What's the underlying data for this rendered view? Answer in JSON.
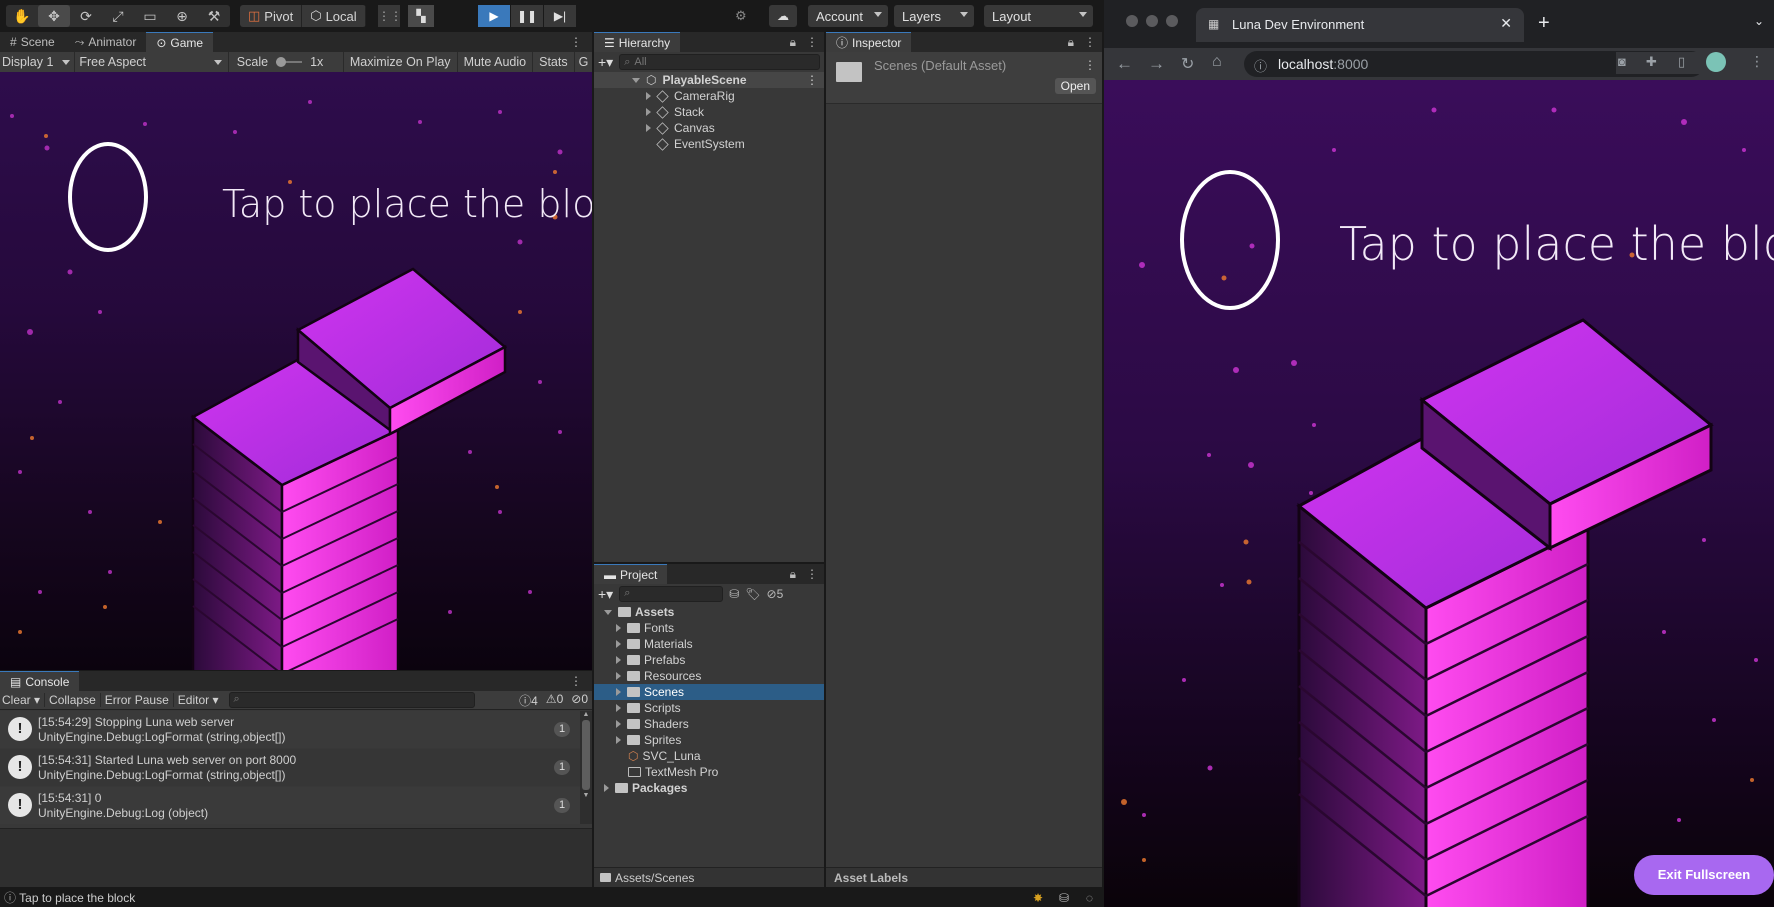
{
  "toolbar": {
    "pivot_label": "Pivot",
    "local_label": "Local",
    "account_label": "Account",
    "layers_label": "Layers",
    "layout_label": "Layout"
  },
  "scene_tabs": {
    "scene": "Scene",
    "animator": "Animator",
    "game": "Game"
  },
  "game_toolbar": {
    "display": "Display 1",
    "aspect": "Free Aspect",
    "scale_label": "Scale",
    "scale_value": "1x",
    "maximize": "Maximize On Play",
    "mute": "Mute Audio",
    "stats": "Stats",
    "gizmos": "G"
  },
  "game": {
    "prompt": "Tap to place the block"
  },
  "hierarchy": {
    "title": "Hierarchy",
    "search_placeholder": "All",
    "scene_name": "PlayableScene",
    "items": [
      "CameraRig",
      "Stack",
      "Canvas",
      "EventSystem"
    ]
  },
  "inspector": {
    "title": "Inspector",
    "asset_name": "Scenes (Default Asset)",
    "open_label": "Open",
    "footer": "Asset Labels"
  },
  "project": {
    "title": "Project",
    "hidden_count": "5",
    "root": "Assets",
    "folders": [
      "Fonts",
      "Materials",
      "Prefabs",
      "Resources",
      "Scenes",
      "Scripts",
      "Shaders",
      "Sprites"
    ],
    "selected": "Scenes",
    "files": [
      "SVC_Luna",
      "TextMesh Pro"
    ],
    "packages": "Packages",
    "breadcrumb": "Assets/Scenes"
  },
  "console": {
    "title": "Console",
    "clear": "Clear",
    "collapse": "Collapse",
    "error_pause": "Error Pause",
    "editor": "Editor",
    "info_count": "4",
    "warn_count": "0",
    "error_count": "0",
    "entries": [
      {
        "line1": "[15:54:29] Stopping Luna web server",
        "line2": "UnityEngine.Debug:LogFormat (string,object[])",
        "count": "1"
      },
      {
        "line1": "[15:54:31] Started Luna web server on port 8000",
        "line2": "UnityEngine.Debug:LogFormat (string,object[])",
        "count": "1"
      },
      {
        "line1": "[15:54:31] 0",
        "line2": "UnityEngine.Debug:Log (object)",
        "count": "1"
      }
    ]
  },
  "status_bar": {
    "message": "Tap to place the block"
  },
  "browser": {
    "tab_title": "Luna Dev Environment",
    "url_host": "localhost",
    "url_port": ":8000",
    "prompt": "Tap to place the block",
    "exit_fullscreen": "Exit Fullscreen"
  }
}
